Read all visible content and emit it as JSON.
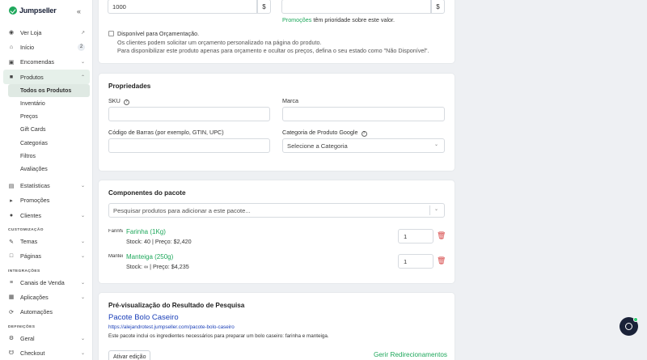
{
  "brand": {
    "name": "Jumpseller",
    "color": "#1fa85c"
  },
  "sidebar": {
    "items": [
      {
        "label": "Ver Loja",
        "icon": "eye-icon",
        "trail": "external-link-icon"
      },
      {
        "label": "Início",
        "icon": "home-icon",
        "badge": "2"
      },
      {
        "label": "Encomendas",
        "icon": "inbox-icon",
        "trail": "chevron-down-icon"
      },
      {
        "label": "Produtos",
        "icon": "box-icon",
        "trail": "chevron-up-icon",
        "active": true
      }
    ],
    "sub_items": [
      "Todos os Produtos",
      "Inventário",
      "Preços",
      "Gift Cards",
      "Categorias",
      "Filtros",
      "Avaliações"
    ],
    "items2": [
      {
        "label": "Estatísticas",
        "icon": "chart-icon"
      },
      {
        "label": "Promoções",
        "icon": "megaphone-icon"
      },
      {
        "label": "Clientes",
        "icon": "users-icon"
      }
    ],
    "section_custom": "CUSTOMIZAÇÃO",
    "items3": [
      {
        "label": "Temas",
        "icon": "brush-icon"
      },
      {
        "label": "Páginas",
        "icon": "page-icon"
      }
    ],
    "section_integrations": "INTEGRAÇÕES",
    "items4": [
      {
        "label": "Canais de Venda",
        "icon": "channels-icon"
      },
      {
        "label": "Aplicações",
        "icon": "apps-icon"
      },
      {
        "label": "Automações",
        "icon": "automation-icon"
      }
    ],
    "section_settings": "DEFINIÇÕES",
    "items5": [
      {
        "label": "Geral",
        "icon": "gear-icon"
      },
      {
        "label": "Checkout",
        "icon": "cart-icon"
      }
    ]
  },
  "pricing": {
    "price_value": "1000",
    "currency": "$",
    "compare_currency": "$",
    "promo_link": "Promoções",
    "promo_text": " têm prioridade sobre este valor."
  },
  "quote": {
    "checkbox_label": "Disponível para Orçamentação.",
    "desc1": "Os clientes podem solicitar um orçamento personalizado na página do produto.",
    "desc2": "Para disponibilizar este produto apenas para orçamento e ocultar os preços, defina o seu estado como \"Não Disponível\"."
  },
  "properties": {
    "title": "Propriedades",
    "sku_label": "SKU",
    "brand_label": "Marca",
    "barcode_label": "Código de Barras (por exemplo, GTIN, UPC)",
    "google_cat_label": "Categoria de Produto Google",
    "google_cat_placeholder": "Selecione a Categoria"
  },
  "bundle": {
    "title": "Componentes do pacote",
    "search_placeholder": "Pesquisar produtos para adicionar a este pacote...",
    "items": [
      {
        "name": "Farinha (1Kg)",
        "stock": "Stock: 40 | Preço: $2,420",
        "img_alt": "Farinha",
        "qty": "1"
      },
      {
        "name": "Manteiga (250g)",
        "stock": "Stock: ∞ | Preço: $4,235",
        "img_alt": "Manteiga",
        "qty": "1"
      }
    ]
  },
  "seo": {
    "title": "Pré-visualização do Resultado de Pesquisa",
    "result_title": "Pacote Bolo Caseiro",
    "result_url": "https://alejandrotest.jumpseller.com/pacote-bolo-caseiro",
    "result_desc": "Este pacote inclui os ingredientes necessários para preparar um bolo caseiro: farinha e manteiga.",
    "edit_button": "Ativar edição",
    "redirects_link": "Gerir Redirecionamentos"
  }
}
